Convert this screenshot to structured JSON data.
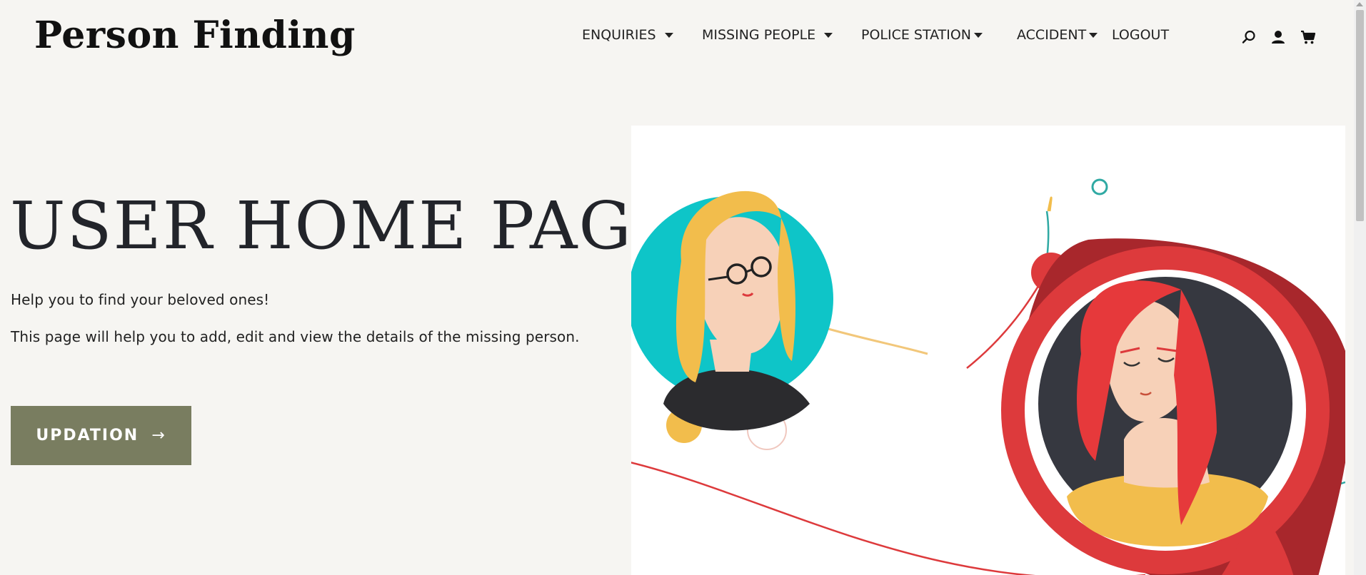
{
  "header": {
    "logo_text": "Person Finding",
    "nav": [
      {
        "label": "ENQUIRIES",
        "has_dropdown": true
      },
      {
        "label": "MISSING PEOPLE",
        "has_dropdown": true
      },
      {
        "label": "POLICE STATION",
        "has_dropdown": true
      },
      {
        "label": "ACCIDENT",
        "has_dropdown": true
      },
      {
        "label": "LOGOUT",
        "has_dropdown": false
      }
    ],
    "icons": [
      "search-icon",
      "user-icon",
      "cart-icon"
    ]
  },
  "hero": {
    "title": "USER HOME PAGE",
    "subtitle": "Help you to find your beloved ones!",
    "description": "This page will help you to add, edit and view the details of the missing person.",
    "cta_label": "UPDATION",
    "cta_arrow": "→"
  },
  "colors": {
    "background": "#f6f5f2",
    "button": "#797d60",
    "teal": "#0ec5c8",
    "red": "#dd3a3c",
    "yellow": "#f2bd4c",
    "dark": "#363840"
  }
}
